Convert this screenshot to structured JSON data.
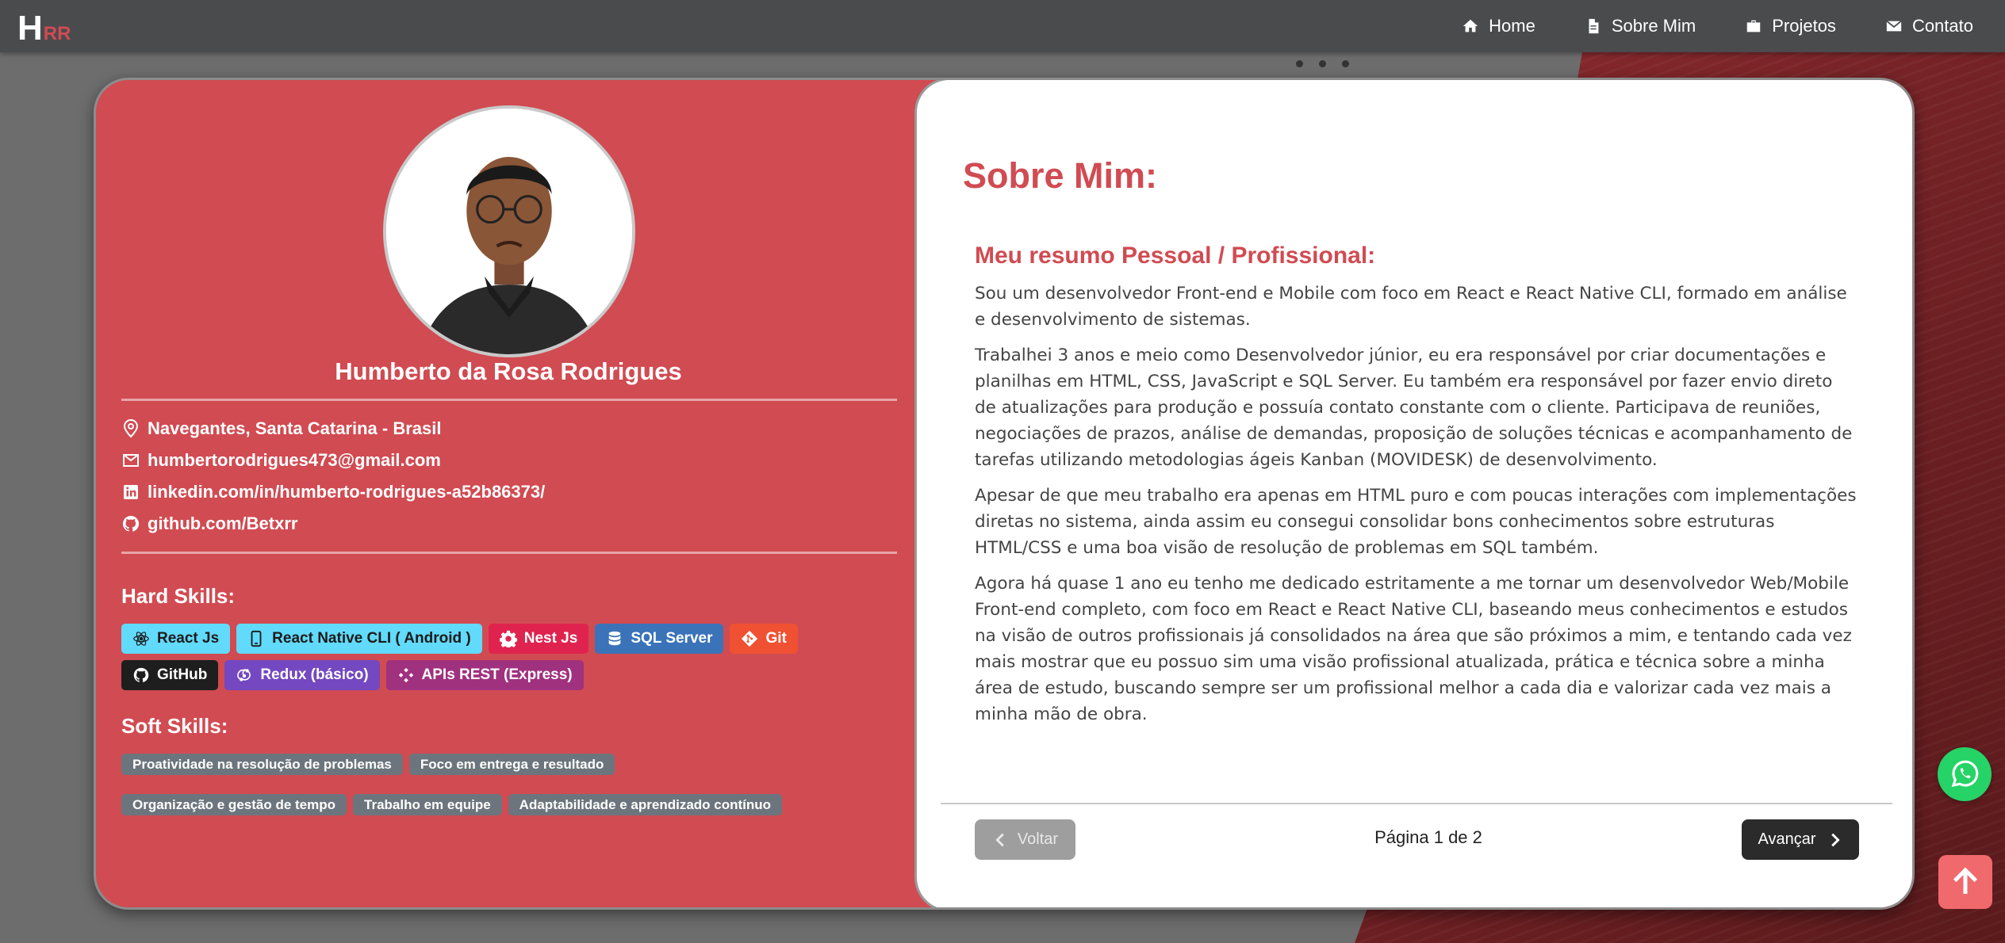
{
  "navbar": {
    "logo_big": "H",
    "logo_small": "RR",
    "links": [
      {
        "label": "Home",
        "icon": "home-icon"
      },
      {
        "label": "Sobre Mim",
        "icon": "document-icon"
      },
      {
        "label": "Projetos",
        "icon": "briefcase-icon"
      },
      {
        "label": "Contato",
        "icon": "envelope-icon"
      }
    ]
  },
  "profile": {
    "name": "Humberto da Rosa Rodrigues",
    "location": "Navegantes, Santa Catarina - Brasil",
    "email": "humbertorodrigues473@gmail.com",
    "linkedin": "linkedin.com/in/humberto-rodrigues-a52b86373/",
    "github": "github.com/Betxrr"
  },
  "hard_skills": {
    "title": "Hard Skills:",
    "items": [
      {
        "label": "React Js",
        "bg": "#61dafb",
        "fg": "#1a1a1a",
        "icon": "react-icon"
      },
      {
        "label": "React Native CLI ( Android )",
        "bg": "#61dafb",
        "fg": "#1a1a1a",
        "icon": "mobile-icon"
      },
      {
        "label": "Nest Js",
        "bg": "#e0234e",
        "fg": "#ffffff",
        "icon": "gear-icon"
      },
      {
        "label": "SQL Server",
        "bg": "#3b73b9",
        "fg": "#ffffff",
        "icon": "database-icon"
      },
      {
        "label": "Git",
        "bg": "#f05133",
        "fg": "#ffffff",
        "icon": "git-icon"
      },
      {
        "label": "GitHub",
        "bg": "#1e1e1e",
        "fg": "#ffffff",
        "icon": "github-icon"
      },
      {
        "label": "Redux (básico)",
        "bg": "#7448c0",
        "fg": "#ffffff",
        "icon": "redux-icon"
      },
      {
        "label": "APIs REST (Express)",
        "bg": "#a0317f",
        "fg": "#ffffff",
        "icon": "network-icon"
      }
    ]
  },
  "soft_skills": {
    "title": "Soft Skills:",
    "items": [
      "Proatividade na resolução de problemas",
      "Foco em entrega e resultado",
      "Organização e gestão de tempo",
      "Trabalho em equipe",
      "Adaptabilidade e aprendizado contínuo"
    ]
  },
  "about": {
    "title": "Sobre Mim:",
    "subtitle": "Meu resumo Pessoal / Profissional:",
    "paragraphs": [
      "Sou um desenvolvedor Front-end e Mobile com foco em React e React Native CLI, formado em análise e desenvolvimento de sistemas.",
      "Trabalhei 3 anos e meio como Desenvolvedor júnior, eu era responsável por criar documentações e planilhas em HTML, CSS, JavaScript e SQL Server. Eu também era responsável por fazer envio direto de atualizações para produção e possuía contato constante com o cliente. Participava de reuniões, negociações de prazos, análise de demandas, proposição de soluções técnicas e acompanhamento de tarefas utilizando metodologias ágeis Kanban (MOVIDESK) de desenvolvimento.",
      "Apesar de que meu trabalho era apenas em HTML puro e com poucas interações com implementações diretas no sistema, ainda assim eu consegui consolidar bons conhecimentos sobre estruturas HTML/CSS e uma boa visão de resolução de problemas em SQL também.",
      "Agora há quase 1 ano eu tenho me dedicado estritamente a me tornar um desenvolvedor Web/Mobile Front-end completo, com foco em React e React Native CLI, baseando meus conhecimentos e estudos na visão de outros profissionais já consolidados na área que são próximos a mim, e tentando cada vez mais mostrar que eu possuo sim uma visão profissional atualizada, prática e técnica sobre a minha área de estudo, buscando sempre ser um profissional melhor a cada dia e valorizar cada vez mais a minha mão de obra."
    ],
    "back_label": "Voltar",
    "next_label": "Avançar",
    "page_indicator": "Página 1 de 2"
  },
  "colors": {
    "accent": "#d14b52",
    "nav_bg": "#4a4b4d",
    "whatsapp": "#25d366",
    "to_top": "#f0696c"
  }
}
